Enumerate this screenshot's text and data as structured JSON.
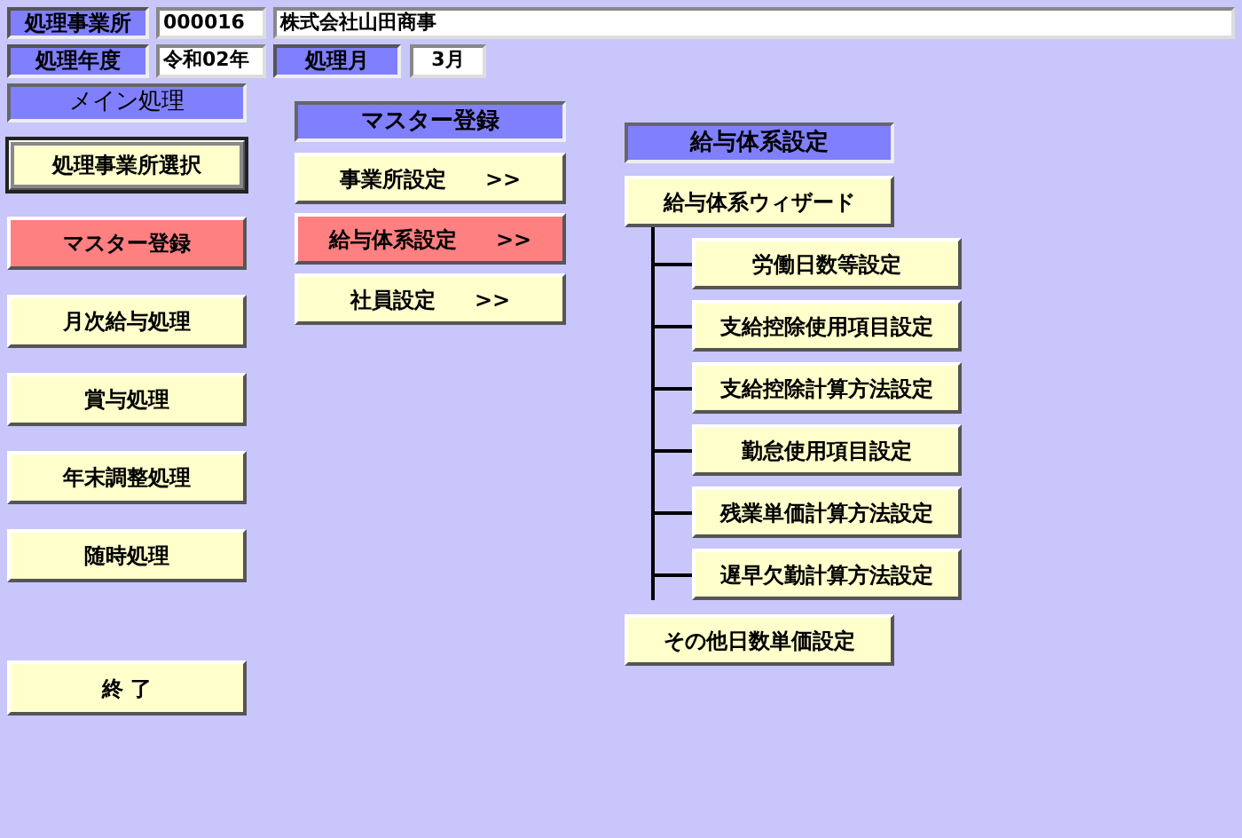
{
  "header": {
    "office": {
      "label": "処理事業所",
      "code": "000016",
      "name": "株式会社山田商事"
    },
    "year": {
      "label": "処理年度",
      "value": "令和02年"
    },
    "month": {
      "label": "処理月",
      "value": "3月"
    }
  },
  "main_menu": {
    "title": "メイン処理",
    "items": [
      {
        "label": "処理事業所選択",
        "selected": false,
        "focused": true
      },
      {
        "label": "マスター登録",
        "selected": true,
        "focused": false
      },
      {
        "label": "月次給与処理",
        "selected": false,
        "focused": false
      },
      {
        "label": "賞与処理",
        "selected": false,
        "focused": false
      },
      {
        "label": "年末調整処理",
        "selected": false,
        "focused": false
      },
      {
        "label": "随時処理",
        "selected": false,
        "focused": false
      }
    ],
    "exit": "終 了"
  },
  "master_menu": {
    "title": "マスター登録",
    "items": [
      {
        "label": "事業所設定",
        "arrow": ">>",
        "selected": false
      },
      {
        "label": "給与体系設定",
        "arrow": ">>",
        "selected": true
      },
      {
        "label": "社員設定",
        "arrow": ">>",
        "selected": false
      }
    ]
  },
  "salary_menu": {
    "title": "給与体系設定",
    "wizard": {
      "label": "給与体系ウィザード",
      "children": [
        {
          "label": "労働日数等設定"
        },
        {
          "label": "支給控除使用項目設定"
        },
        {
          "label": "支給控除計算方法設定"
        },
        {
          "label": "勤怠使用項目設定"
        },
        {
          "label": "残業単価計算方法設定"
        },
        {
          "label": "遅早欠勤計算方法設定"
        }
      ]
    },
    "other": "その他日数単価設定"
  }
}
